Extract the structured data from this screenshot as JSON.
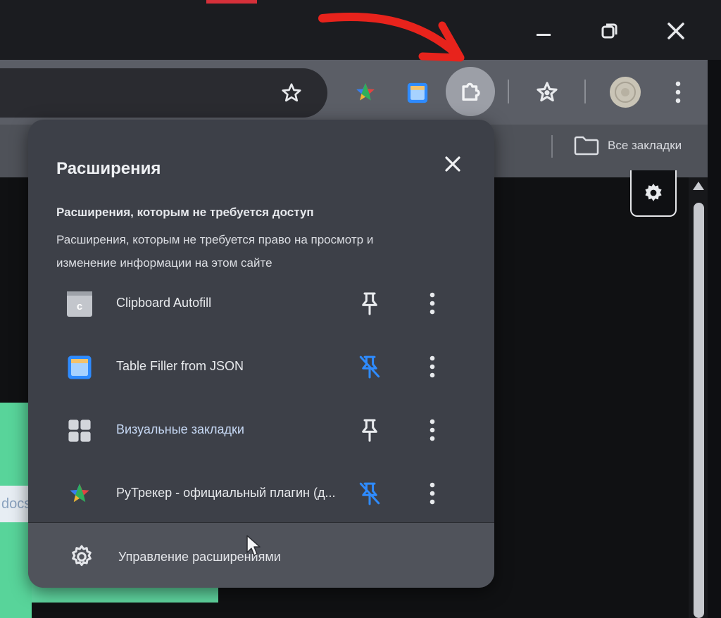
{
  "window": {
    "minimize_icon": "minimize-icon",
    "restore_icon": "restore-icon",
    "close_icon": "close-icon",
    "accent_color": "#d6303a"
  },
  "toolbar": {
    "bookmark_star_icon": "star-icon",
    "extension_icons": [
      "rutracker-icon",
      "table-filler-icon"
    ],
    "extensions_button_icon": "puzzle-icon",
    "bookmarks_manager_icon": "star-bookmarks-icon",
    "profile_icon": "avatar",
    "menu_icon": "more-vertical-icon"
  },
  "bookmarks_bar": {
    "all_bookmarks_label": "Все закладки",
    "folder_icon": "folder-icon"
  },
  "page": {
    "docs_text": "docs",
    "settings_icon": "gear-icon"
  },
  "popup": {
    "title": "Расширения",
    "section_heading": "Расширения, которым не требуется доступ",
    "section_description": "Расширения, которым не требуется право на просмотр и изменение информации на этом сайте",
    "extensions": [
      {
        "name": "Clipboard Autofill",
        "icon": "clipboard-autofill-icon",
        "pinned": false
      },
      {
        "name": "Table Filler from JSON",
        "icon": "table-filler-icon",
        "pinned": true
      },
      {
        "name": "Визуальные закладки",
        "icon": "visual-bookmarks-icon",
        "pinned": false
      },
      {
        "name": "РуТрекер - официальный плагин (д...",
        "icon": "rutracker-icon",
        "pinned": true
      }
    ],
    "manage_label": "Управление расширениями",
    "accent_color": "#2e8bff"
  },
  "annotation": {
    "arrow_color": "#e8231c"
  }
}
